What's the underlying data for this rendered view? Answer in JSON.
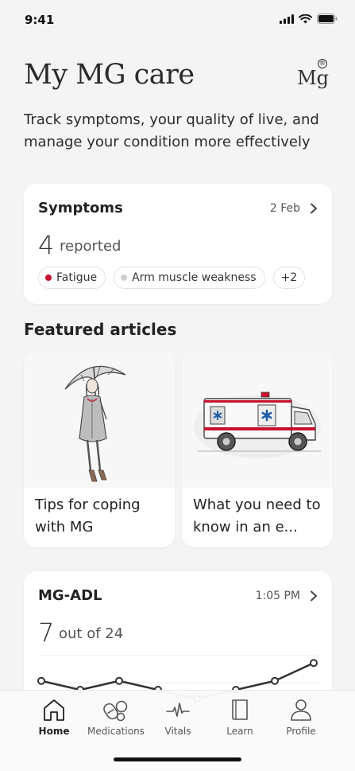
{
  "status": {
    "time": "9:41"
  },
  "header": {
    "title": "My MG care",
    "brand_mark": "Mg",
    "brand_reg": "®",
    "subtitle": "Track symptoms, your quality of live, and manage your condition more effectively"
  },
  "symptoms": {
    "title": "Symptoms",
    "date": "2 Feb",
    "count": "4",
    "count_label": "reported",
    "chips": [
      {
        "label": "Fatigue",
        "dot_color": "#c8102e"
      },
      {
        "label": "Arm muscle weakness",
        "dot_color": "#cfcfcf"
      },
      {
        "label": "+2"
      }
    ]
  },
  "featured": {
    "title": "Featured articles",
    "articles": [
      {
        "title": "Tips for coping with MG",
        "image_icon": "woman-with-umbrella-illustration"
      },
      {
        "title": "What you need to know in an e...",
        "image_icon": "ambulance-illustration"
      }
    ]
  },
  "adl": {
    "title": "MG-ADL",
    "time": "1:05 PM",
    "score": "7",
    "score_label": "out of 24"
  },
  "chart_data": {
    "type": "line",
    "series": [
      {
        "values": [
          9,
          8,
          9,
          8,
          7,
          8,
          9,
          11
        ]
      }
    ],
    "ylim": [
      0,
      24
    ],
    "grid": true
  },
  "tabs": [
    {
      "label": "Home",
      "icon": "home-icon",
      "active": true
    },
    {
      "label": "Medications",
      "icon": "pills-icon"
    },
    {
      "label": "Vitals",
      "icon": "pulse-icon"
    },
    {
      "label": "Learn",
      "icon": "book-icon"
    },
    {
      "label": "Profile",
      "icon": "person-icon"
    }
  ],
  "colors": {
    "accent_red": "#c8102e",
    "background": "#f4f4f4"
  }
}
